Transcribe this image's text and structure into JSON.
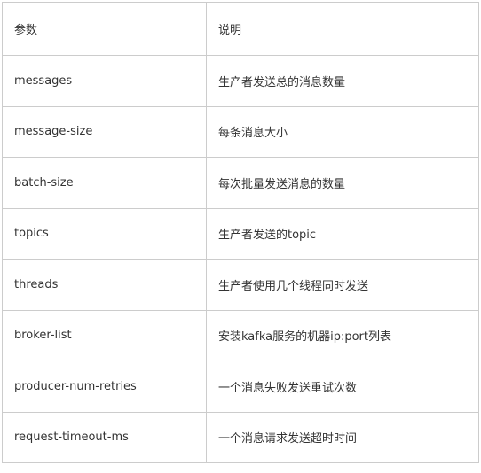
{
  "table": {
    "headers": [
      "参数",
      "说明"
    ],
    "rows": [
      [
        "messages",
        "生产者发送总的消息数量"
      ],
      [
        "message-size",
        "每条消息大小"
      ],
      [
        "batch-size",
        "每次批量发送消息的数量"
      ],
      [
        "topics",
        "生产者发送的topic"
      ],
      [
        "threads",
        "生产者使用几个线程同时发送"
      ],
      [
        "broker-list",
        "安装kafka服务的机器ip:port列表"
      ],
      [
        "producer-num-retries",
        "一个消息失败发送重试次数"
      ],
      [
        "request-timeout-ms",
        "一个消息请求发送超时时间"
      ]
    ]
  }
}
